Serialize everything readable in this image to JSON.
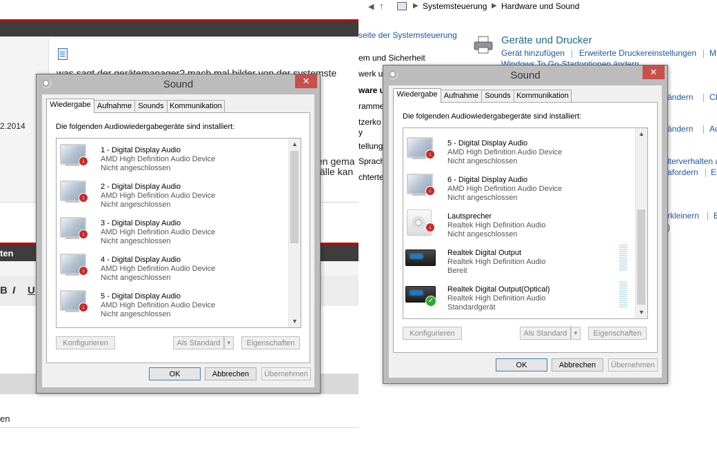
{
  "forum": {
    "post_text": "was sagt der gerätemanager? mach mal bilder von der systemste",
    "date": "2.2014",
    "side_text_1": "en gema",
    "side_text_2": "fälle kan",
    "section_header": "ten",
    "toolbar": {
      "bold": "B",
      "italic": "I",
      "underline": "U"
    },
    "bottom_text": "en"
  },
  "control_panel": {
    "nav": {
      "back": "◀",
      "forward": "▶",
      "up": "↑"
    },
    "breadcrumb": [
      "Systemsteuerung",
      "Hardware und Sound"
    ],
    "left_nav": [
      "seite der Systemsteuerung",
      "em und Sicherheit",
      "werk u",
      "ware u",
      "ramme",
      "tzerko",
      "y",
      "tellung",
      "Sprach",
      "chterte"
    ],
    "section_title": "Geräte und Drucker",
    "links": [
      "Gerät hinzufügen",
      "Erweiterte Druckereinstellungen",
      "M",
      "Windows To Go-Startoptionen ändern",
      "ändern",
      "CD",
      "ändern",
      "Au",
      "lterverhalten a",
      "afordern",
      "Er",
      "rkleinern",
      "E",
      ")"
    ]
  },
  "dialog_left": {
    "title": "Sound",
    "close": "✕",
    "tabs": [
      "Wiedergabe",
      "Aufnahme",
      "Sounds",
      "Kommunikation"
    ],
    "instruction": "Die folgenden Audiowiedergabegeräte sind installiert:",
    "devices": [
      {
        "name": "1 - Digital Display Audio",
        "driver": "AMD High Definition Audio Device",
        "status": "Nicht angeschlossen"
      },
      {
        "name": "2 - Digital Display Audio",
        "driver": "AMD High Definition Audio Device",
        "status": "Nicht angeschlossen"
      },
      {
        "name": "3 - Digital Display Audio",
        "driver": "AMD High Definition Audio Device",
        "status": "Nicht angeschlossen"
      },
      {
        "name": "4 - Digital Display Audio",
        "driver": "AMD High Definition Audio Device",
        "status": "Nicht angeschlossen"
      },
      {
        "name": "5 - Digital Display Audio",
        "driver": "AMD High Definition Audio Device",
        "status": "Nicht angeschlossen"
      }
    ],
    "buttons": {
      "configure": "Konfigurieren",
      "set_default": "Als Standard",
      "properties": "Eigenschaften",
      "ok": "OK",
      "cancel": "Abbrechen",
      "apply": "Übernehmen"
    },
    "scroll_up": "▲",
    "scroll_down": "▼",
    "dropdown_arrow": "▼"
  },
  "dialog_right": {
    "title": "Sound",
    "close": "✕",
    "tabs": [
      "Wiedergabe",
      "Aufnahme",
      "Sounds",
      "Kommunikation"
    ],
    "instruction": "Die folgenden Audiowiedergabegeräte sind installiert:",
    "devices": [
      {
        "name": "5 - Digital Display Audio",
        "driver": "AMD High Definition Audio Device",
        "status": "Nicht angeschlossen",
        "icon": "monitor-icon",
        "badge": "disconnected"
      },
      {
        "name": "6 - Digital Display Audio",
        "driver": "AMD High Definition Audio Device",
        "status": "Nicht angeschlossen",
        "icon": "monitor-icon",
        "badge": "disconnected"
      },
      {
        "name": "Lautsprecher",
        "driver": "Realtek High Definition Audio",
        "status": "Nicht angeschlossen",
        "icon": "speaker-icon",
        "badge": "disconnected"
      },
      {
        "name": "Realtek Digital Output",
        "driver": "Realtek High Definition Audio",
        "status": "Bereit",
        "icon": "receiver-icon",
        "badge": "none"
      },
      {
        "name": "Realtek Digital Output(Optical)",
        "driver": "Realtek High Definition Audio",
        "status": "Standardgerät",
        "icon": "receiver-icon",
        "badge": "default"
      }
    ],
    "buttons": {
      "configure": "Konfigurieren",
      "set_default": "Als Standard",
      "properties": "Eigenschaften",
      "ok": "OK",
      "cancel": "Abbrechen",
      "apply": "Übernehmen"
    },
    "scroll_up": "▲",
    "scroll_down": "▼",
    "dropdown_arrow": "▼",
    "badge_glyphs": {
      "disconnected": "↓",
      "default": "✓"
    }
  },
  "colors": {
    "forum_red": "#c00000",
    "link_blue": "#1e56a0",
    "close_red": "#c7504a",
    "dialog_frame": "#bcbcbc"
  }
}
